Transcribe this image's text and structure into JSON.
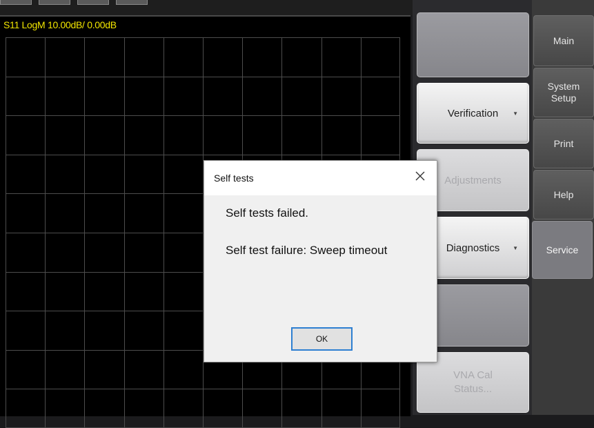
{
  "trace": {
    "title": "S11 LogM 10.00dB/  0.00dB",
    "trace_color": "#f2e600",
    "grid_color": "#4d4d4d"
  },
  "softkeys": [
    {
      "label": "",
      "state": "empty"
    },
    {
      "label": "Verification",
      "state": "active",
      "has_submenu": true
    },
    {
      "label": "Adjustments",
      "state": "disabled"
    },
    {
      "label": "Diagnostics",
      "state": "active",
      "has_submenu": true
    },
    {
      "label": "",
      "state": "empty"
    },
    {
      "label": "VNA Cal Status...",
      "state": "disabled"
    }
  ],
  "menu_tabs": [
    {
      "label": "Main",
      "selected": false
    },
    {
      "label": "System Setup",
      "selected": false
    },
    {
      "label": "Print",
      "selected": false
    },
    {
      "label": "Help",
      "selected": false
    },
    {
      "label": "Service",
      "selected": true
    }
  ],
  "dialog": {
    "title": "Self tests",
    "close_glyph": "✕",
    "message_1": "Self tests failed.",
    "message_2": "Self test failure: Sweep timeout",
    "ok_label": "OK",
    "focus_color": "#2d7fd1"
  },
  "icons": {
    "close": "close-icon",
    "submenu": "submenu-arrow-icon"
  }
}
